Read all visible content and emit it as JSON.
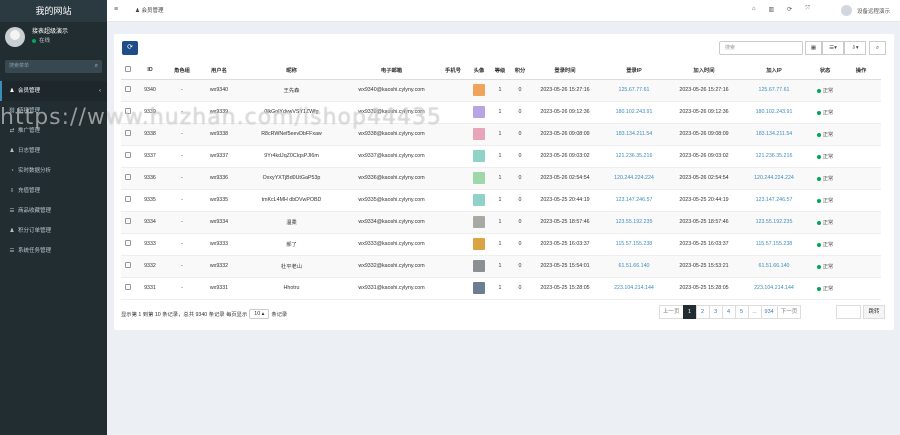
{
  "sidebar": {
    "brand": "我的网站",
    "user_name": "接表超级演示",
    "user_status": "在线",
    "search_placeholder": "搜索菜单",
    "items": [
      {
        "label": "会员管理",
        "icon": "user-icon",
        "active": true,
        "caret": "‹"
      },
      {
        "label": "链接管理",
        "icon": "link-icon",
        "active": false,
        "caret": ""
      },
      {
        "label": "推广管理",
        "icon": "share-icon",
        "active": false,
        "caret": ""
      },
      {
        "label": "日志管理",
        "icon": "user-icon",
        "active": false,
        "caret": ""
      },
      {
        "label": "实时数据分析",
        "icon": "chart-icon",
        "active": false,
        "caret": ""
      },
      {
        "label": "充值管理",
        "icon": "download-icon",
        "active": false,
        "caret": ""
      },
      {
        "label": "商品收藏管理",
        "icon": "list-icon",
        "active": false,
        "caret": ""
      },
      {
        "label": "积分订单管理",
        "icon": "user-icon",
        "active": false,
        "caret": ""
      },
      {
        "label": "系统任务管理",
        "icon": "list-icon",
        "active": false,
        "caret": ""
      }
    ]
  },
  "topbar": {
    "tab_label": "会员管理",
    "user_label": "设备远程演示"
  },
  "toolbar": {
    "search_placeholder": "搜索",
    "refresh": "⟳"
  },
  "table": {
    "headers": [
      "",
      "ID",
      "角色组",
      "用户名",
      "昵称",
      "电子邮箱",
      "手机号",
      "头像",
      "等级",
      "积分",
      "登录时间",
      "登录IP",
      "加入时间",
      "加入IP",
      "状态",
      "操作"
    ],
    "rows": [
      {
        "id": "9340",
        "role": "-",
        "username": "wx9340",
        "nickname": "王先森",
        "email": "wx9340@kaoshi.cylyny.com",
        "phone": "",
        "level": "1",
        "score": "0",
        "login_time": "2023-05-26 15:27:16",
        "login_ip": "125.67.77.61",
        "join_time": "2023-05-26 15:27:16",
        "join_ip": "125.67.77.61",
        "status": "正常",
        "avatar_color": "#f0a35b"
      },
      {
        "id": "9339",
        "role": "-",
        "username": "wx9339",
        "nickname": "0lkGnlYdvwVSY1ZWfg",
        "email": "wx9339@kaoshi.cylyny.com",
        "phone": "",
        "level": "1",
        "score": "0",
        "login_time": "2023-05-26 09:12:36",
        "login_ip": "180.102.243.91",
        "join_time": "2023-05-26 09:12:36",
        "join_ip": "180.102.243.91",
        "status": "正常",
        "avatar_color": "#b9a3e3"
      },
      {
        "id": "9338",
        "role": "-",
        "username": "wx9338",
        "nickname": "R8cRWNef5eevDbFFxaw",
        "email": "wx9338@kaoshi.cylyny.com",
        "phone": "",
        "level": "1",
        "score": "0",
        "login_time": "2023-05-26 09:08:09",
        "login_ip": "183.134.211.54",
        "join_time": "2023-05-26 09:08:09",
        "join_ip": "183.134.211.54",
        "status": "正常",
        "avatar_color": "#e8a4b8"
      },
      {
        "id": "9337",
        "role": "-",
        "username": "wx9337",
        "nickname": "9Yr4kdJqZ0CIqsPJI6m",
        "email": "wx9337@kaoshi.cylyny.com",
        "phone": "",
        "level": "1",
        "score": "0",
        "login_time": "2023-05-26 09:03:02",
        "login_ip": "121.236.35.216",
        "join_time": "2023-05-26 09:03:02",
        "join_ip": "121.236.35.216",
        "status": "正常",
        "avatar_color": "#8fd3c8"
      },
      {
        "id": "9336",
        "role": "-",
        "username": "wx9336",
        "nickname": "OxxyYXTjBd0UtGaP53p",
        "email": "wx9336@kaoshi.cylyny.com",
        "phone": "",
        "level": "1",
        "score": "0",
        "login_time": "2023-05-26 02:54:54",
        "login_ip": "120.244.224.224",
        "join_time": "2023-05-26 02:54:54",
        "join_ip": "120.244.224.224",
        "status": "正常",
        "avatar_color": "#9ed8a8"
      },
      {
        "id": "9335",
        "role": "-",
        "username": "wx9335",
        "nickname": "tmKcL4MH dbDVwPOBD",
        "email": "wx9335@kaoshi.cylyny.com",
        "phone": "",
        "level": "1",
        "score": "0",
        "login_time": "2023-05-25 20:44:19",
        "login_ip": "123.147.246.57",
        "join_time": "2023-05-25 20:44:19",
        "join_ip": "123.147.246.57",
        "status": "正常",
        "avatar_color": "#8fd3c8"
      },
      {
        "id": "9334",
        "role": "-",
        "username": "wx9334",
        "nickname": "温柔",
        "email": "wx9334@kaoshi.cylyny.com",
        "phone": "",
        "level": "1",
        "score": "0",
        "login_time": "2023-05-25 18:57:46",
        "login_ip": "123.55.192.235",
        "join_time": "2023-05-25 18:57:46",
        "join_ip": "123.55.192.235",
        "status": "正常",
        "avatar_color": "#a7a9a5"
      },
      {
        "id": "9333",
        "role": "-",
        "username": "wx9333",
        "nickname": "郝了",
        "email": "wx9333@kaoshi.cylyny.com",
        "phone": "",
        "level": "1",
        "score": "0",
        "login_time": "2023-05-25 16:03:37",
        "login_ip": "115.57.155.238",
        "join_time": "2023-05-25 16:03:37",
        "join_ip": "115.57.155.238",
        "status": "正常",
        "avatar_color": "#d9a441"
      },
      {
        "id": "9332",
        "role": "-",
        "username": "wx9332",
        "nickname": "杜平老山",
        "email": "wx9332@kaoshi.cylyny.com",
        "phone": "",
        "level": "1",
        "score": "0",
        "login_time": "2023-05-25 15:54:01",
        "login_ip": "61.51.66.140",
        "join_time": "2023-05-25 15:53:21",
        "join_ip": "61.51.66.140",
        "status": "正常",
        "avatar_color": "#8c8f94"
      },
      {
        "id": "9331",
        "role": "-",
        "username": "wx9331",
        "nickname": "Hhotru",
        "email": "wx9331@kaoshi.cylyny.com",
        "phone": "",
        "level": "1",
        "score": "0",
        "login_time": "2023-05-25 15:28:05",
        "login_ip": "223.104.214.144",
        "join_time": "2023-05-25 15:28:05",
        "join_ip": "223.104.214.144",
        "status": "正常",
        "avatar_color": "#6e7e92"
      }
    ]
  },
  "pagination": {
    "info_prefix": "显示第 1 到第 10 条记录，总共 9340 条记录 每页显示",
    "per_page": "10",
    "info_suffix": "条记录",
    "prev": "上一页",
    "pages": [
      "1",
      "2",
      "3",
      "4",
      "5",
      "...",
      "934"
    ],
    "next": "下一页",
    "jump": "跳转"
  },
  "watermark": "https://www.huzhan.com/ishop44435",
  "colors": {
    "sidebar_bg": "#222d32",
    "accent": "#1f4d8a",
    "link": "#3c8dbc",
    "status_green": "#00a65a"
  }
}
